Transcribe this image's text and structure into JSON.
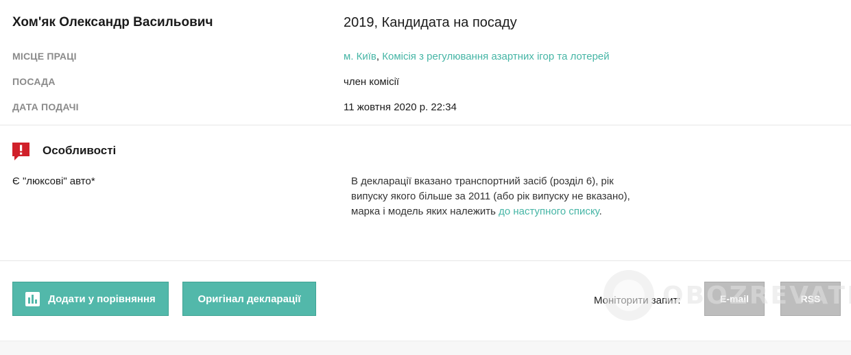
{
  "header": {
    "person_name": "Хом'як Олександр Васильович",
    "declaration_title": "2019, Кандидата на посаду"
  },
  "details": {
    "workplace_label": "МІСЦЕ ПРАЦІ",
    "workplace_city": "м. Київ",
    "workplace_separator": ",",
    "workplace_org": "Комісія з регулювання азартних ігор та лотерей",
    "position_label": "ПОСАДА",
    "position_value": "член комісії",
    "submit_date_label": "ДАТА ПОДАЧІ",
    "submit_date_value": "11 жовтня 2020 р. 22:34"
  },
  "features": {
    "title": "Особливості",
    "icon": "exclamation-flag-icon",
    "items": [
      {
        "name": "Є \"люксові\" авто*",
        "description_lines": [
          "В декларації вказано транспортний засіб (розділ 6), рік",
          "випуску якого більше за 2011 (або рік випуску не вказано),"
        ],
        "description_tail": "марка і модель яких належить",
        "link_text": "до наступного списку",
        "description_end": "."
      }
    ]
  },
  "actions": {
    "compare_label": "Додати у порівняння",
    "compare_icon": "bar-chart-icon",
    "original_label": "Оригінал декларації",
    "monitor_label": "Моніторити запит:",
    "email_label": "E-mail",
    "rss_label": "RSS"
  },
  "watermark": {
    "text": "OBOZREVATEL"
  },
  "colors": {
    "accent": "#52b8aa",
    "link": "#45b5a5",
    "warning": "#d0202a",
    "disabled": "#bdbdbd"
  }
}
